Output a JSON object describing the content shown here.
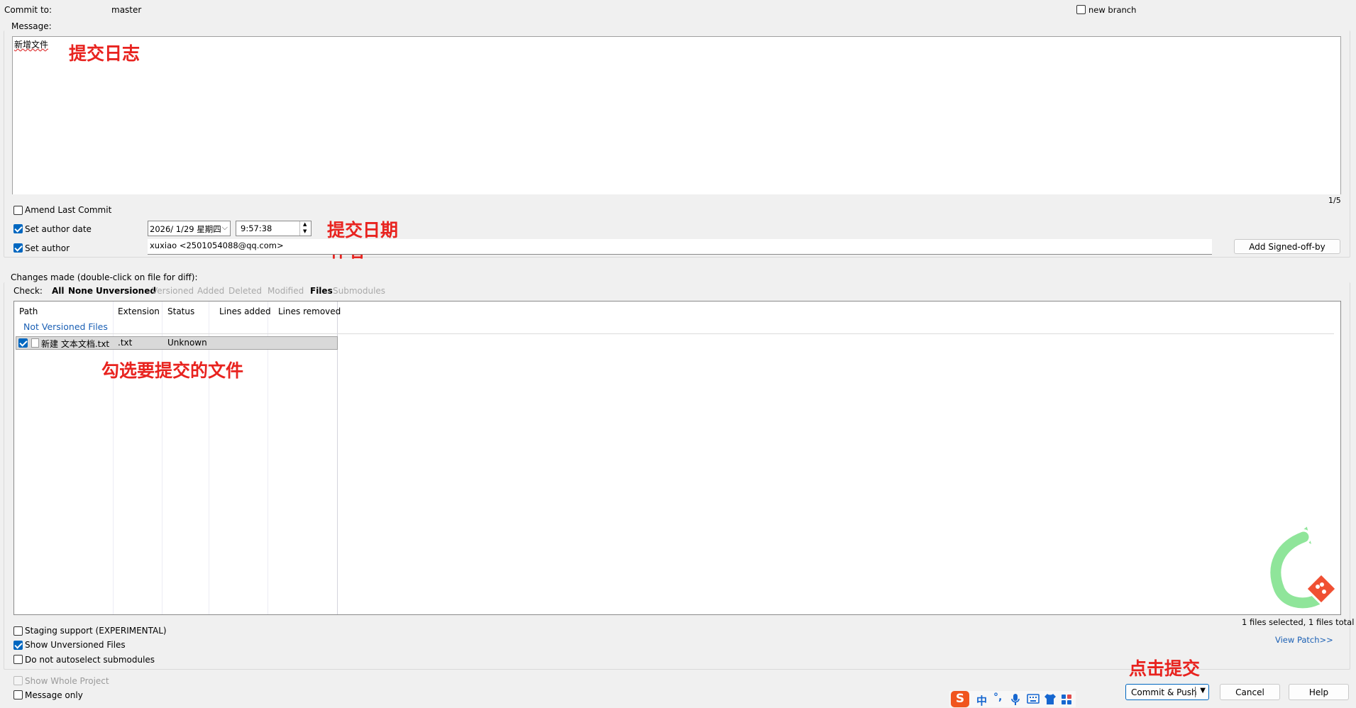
{
  "header": {
    "commit_to_label": "Commit to:",
    "branch": "master",
    "new_branch_label": "new branch"
  },
  "message": {
    "label": "Message:",
    "text": "新增文件",
    "counter": "1/5"
  },
  "options": {
    "amend_label": "Amend Last Commit",
    "set_author_date_label": "Set author date",
    "date_value": "2026/  1/29 星期四",
    "time_value": "9:57:38",
    "set_author_label": "Set author",
    "author_value": "xuxiao <2501054088@qq.com>",
    "signed_off_button": "Add Signed-off-by"
  },
  "changes": {
    "label": "Changes made (double-click on file for diff):",
    "check_label": "Check:",
    "filters": [
      "All",
      "None",
      "Unversioned",
      "Versioned",
      "Added",
      "Deleted",
      "Modified",
      "Files",
      "Submodules"
    ],
    "columns": [
      "Path",
      "Extension",
      "Status",
      "Lines added",
      "Lines removed"
    ],
    "group_label": "Not Versioned Files",
    "file": {
      "path": "新建 文本文档.txt",
      "extension": ".txt",
      "status": "Unknown",
      "lines_added": "",
      "lines_removed": ""
    },
    "selection_summary": "1 files selected, 1 files total",
    "view_patch": "View Patch>>"
  },
  "bottom_options": {
    "staging_label": "Staging support (EXPERIMENTAL)",
    "show_unversioned_label": "Show Unversioned Files",
    "no_autoselect_label": "Do not autoselect submodules",
    "show_whole_project_label": "Show Whole Project",
    "message_only_label": "Message only"
  },
  "buttons": {
    "commit_push": "Commit & Push",
    "cancel": "Cancel",
    "help": "Help"
  },
  "annotations": {
    "log": "提交日志",
    "date": "提交日期",
    "author": "作者",
    "select_files": "勾选要提交的文件",
    "click_commit": "点击提交"
  },
  "ime_bar": {
    "mode": "中",
    "punct": "°,",
    "icons": [
      "sogou-logo-icon",
      "microphone-icon",
      "keyboard-icon",
      "skin-shirt-icon",
      "toolbox-icon"
    ]
  },
  "colors": {
    "accent": "#0067c0",
    "annotation_red": "#e8231f",
    "link_blue": "#1a5fb4",
    "logo_green": "#7fe08a"
  }
}
